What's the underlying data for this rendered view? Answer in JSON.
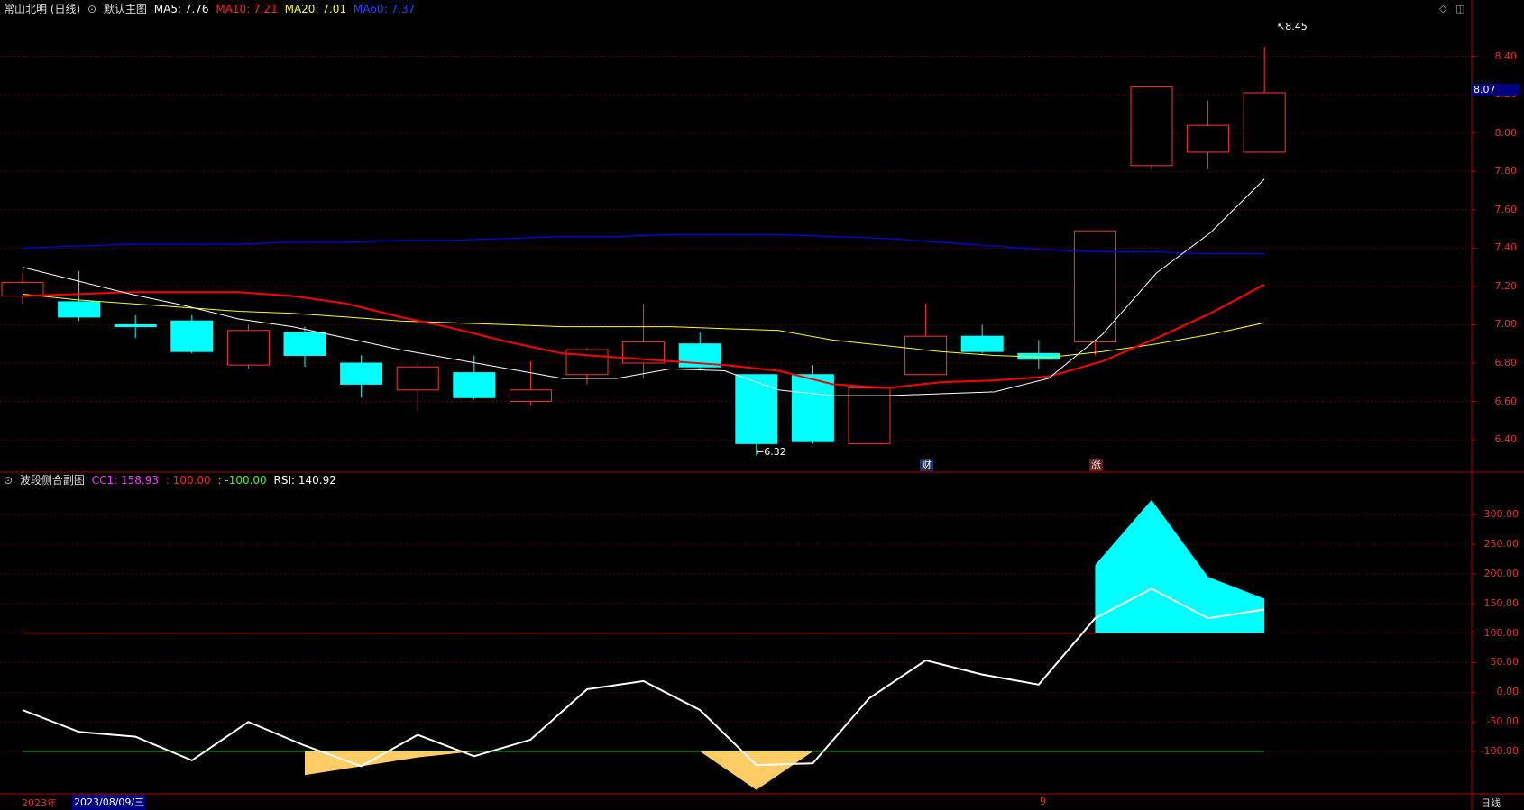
{
  "main_header": {
    "stock_name": "常山北明 (日线)",
    "chart_menu_icon": "gear-icon",
    "chart_name": "默认主图",
    "ma5": "MA5: 7.76",
    "ma10": "MA10: 7.21",
    "ma20": "MA20: 7.01",
    "ma60": "MA60: 7.37"
  },
  "sub_header": {
    "chart_menu_icon": "gear-icon",
    "name": "波段侧合副图",
    "cc1": "CC1: 158.93",
    "upper": ": 100.00",
    "lower": ": -100.00",
    "rsi": "RSI: 140.92"
  },
  "corner_buttons": [
    "◇",
    "◫"
  ],
  "price_axis": [
    "8.40",
    "8.20",
    "8.00",
    "7.80",
    "7.60",
    "7.40",
    "7.20",
    "7.00",
    "6.80",
    "6.60",
    "6.40"
  ],
  "sub_axis": [
    "300.00",
    "250.00",
    "200.00",
    "150.00",
    "100.00",
    "50.00",
    "0.00",
    "-50.00",
    "-100.00"
  ],
  "current_price_tag": "8.07",
  "high_marker": "8.45",
  "low_marker": "6.32",
  "event_tags": {
    "finance": "财",
    "rise": "涨"
  },
  "bottom_bar": {
    "year": "2023年",
    "date": "2023/08/09/三",
    "month": "9",
    "period": "日线"
  },
  "colors": {
    "up": "#ff3333",
    "down": "#00ffff",
    "ma5": "#ffffff",
    "ma10": "#ff0000",
    "ma20": "#ffff00",
    "ma60": "#0000ff",
    "area_pos": "#00ffff",
    "area_neg": "#ffcc66"
  },
  "chart_data": [
    {
      "type": "candlestick",
      "ylim": [
        6.25,
        8.6
      ],
      "candles": [
        {
          "o": 7.15,
          "c": 7.22,
          "h": 7.27,
          "l": 7.11
        },
        {
          "o": 7.12,
          "c": 7.04,
          "h": 7.28,
          "l": 7.02
        },
        {
          "o": 7.0,
          "c": 6.99,
          "h": 7.05,
          "l": 6.93
        },
        {
          "o": 7.02,
          "c": 6.86,
          "h": 7.05,
          "l": 6.85
        },
        {
          "o": 6.79,
          "c": 6.97,
          "h": 7.0,
          "l": 6.77
        },
        {
          "o": 6.96,
          "c": 6.84,
          "h": 6.99,
          "l": 6.78
        },
        {
          "o": 6.8,
          "c": 6.69,
          "h": 6.84,
          "l": 6.62
        },
        {
          "o": 6.66,
          "c": 6.78,
          "h": 6.8,
          "l": 6.55
        },
        {
          "o": 6.75,
          "c": 6.62,
          "h": 6.84,
          "l": 6.61
        },
        {
          "o": 6.6,
          "c": 6.66,
          "h": 6.81,
          "l": 6.58
        },
        {
          "o": 6.74,
          "c": 6.87,
          "h": 6.88,
          "l": 6.69
        },
        {
          "o": 6.8,
          "c": 6.91,
          "h": 7.11,
          "l": 6.72
        },
        {
          "o": 6.9,
          "c": 6.78,
          "h": 6.96,
          "l": 6.76
        },
        {
          "o": 6.74,
          "c": 6.38,
          "h": 6.74,
          "l": 6.32
        },
        {
          "o": 6.74,
          "c": 6.39,
          "h": 6.79,
          "l": 6.38
        },
        {
          "o": 6.38,
          "c": 6.67,
          "h": 6.67,
          "l": 6.38
        },
        {
          "o": 6.74,
          "c": 6.94,
          "h": 7.11,
          "l": 6.74
        },
        {
          "o": 6.94,
          "c": 6.86,
          "h": 7.0,
          "l": 6.85
        },
        {
          "o": 6.85,
          "c": 6.82,
          "h": 6.92,
          "l": 6.77
        },
        {
          "o": 6.91,
          "c": 7.49,
          "h": 7.49,
          "l": 6.84
        },
        {
          "o": 7.83,
          "c": 8.24,
          "h": 8.24,
          "l": 7.81
        },
        {
          "o": 7.9,
          "c": 8.04,
          "h": 8.17,
          "l": 7.81
        },
        {
          "o": 7.9,
          "c": 8.21,
          "h": 8.45,
          "l": 7.9
        }
      ],
      "ma5": [
        7.3,
        7.23,
        7.16,
        7.1,
        7.03,
        6.99,
        6.93,
        6.87,
        6.82,
        6.77,
        6.72,
        6.72,
        6.77,
        6.76,
        6.66,
        6.63,
        6.63,
        6.64,
        6.65,
        6.72,
        6.95,
        7.27,
        7.48,
        7.76
      ],
      "ma10": [
        7.15,
        7.16,
        7.17,
        7.17,
        7.17,
        7.15,
        7.11,
        7.04,
        6.98,
        6.91,
        6.85,
        6.83,
        6.81,
        6.79,
        6.76,
        6.69,
        6.67,
        6.7,
        6.71,
        6.73,
        6.81,
        6.93,
        7.06,
        7.21
      ],
      "ma20": [
        7.16,
        7.13,
        7.11,
        7.09,
        7.07,
        7.06,
        7.04,
        7.02,
        7.01,
        7.0,
        6.99,
        6.99,
        6.99,
        6.98,
        6.97,
        6.92,
        6.89,
        6.86,
        6.84,
        6.83,
        6.86,
        6.9,
        6.95,
        7.01
      ],
      "ma60": [
        7.4,
        7.41,
        7.42,
        7.42,
        7.42,
        7.43,
        7.43,
        7.44,
        7.44,
        7.45,
        7.46,
        7.46,
        7.47,
        7.47,
        7.47,
        7.46,
        7.45,
        7.43,
        7.41,
        7.39,
        7.38,
        7.38,
        7.37,
        7.37
      ]
    },
    {
      "type": "line",
      "ylim": [
        -170,
        340
      ],
      "cc1": [
        -30,
        -67,
        -75,
        -115,
        -50,
        -90,
        -125,
        -72,
        -108,
        -80,
        5,
        19,
        -30,
        -123,
        -120,
        -10,
        54,
        30,
        13,
        125,
        175,
        125,
        140
      ],
      "area": [
        -100,
        -100,
        -100,
        -100,
        -100,
        -100,
        -100,
        -100,
        -100,
        -100,
        -100,
        -100,
        -100,
        -100,
        -100,
        -100,
        100,
        100,
        100,
        100,
        100,
        100,
        100
      ],
      "area_top": [
        null,
        null,
        null,
        null,
        null,
        -140,
        -125,
        -110,
        -100,
        null,
        null,
        null,
        -100,
        -165,
        -100,
        null,
        null,
        null,
        null,
        215,
        325,
        195,
        158
      ],
      "upper": 100,
      "lower": -100
    }
  ]
}
